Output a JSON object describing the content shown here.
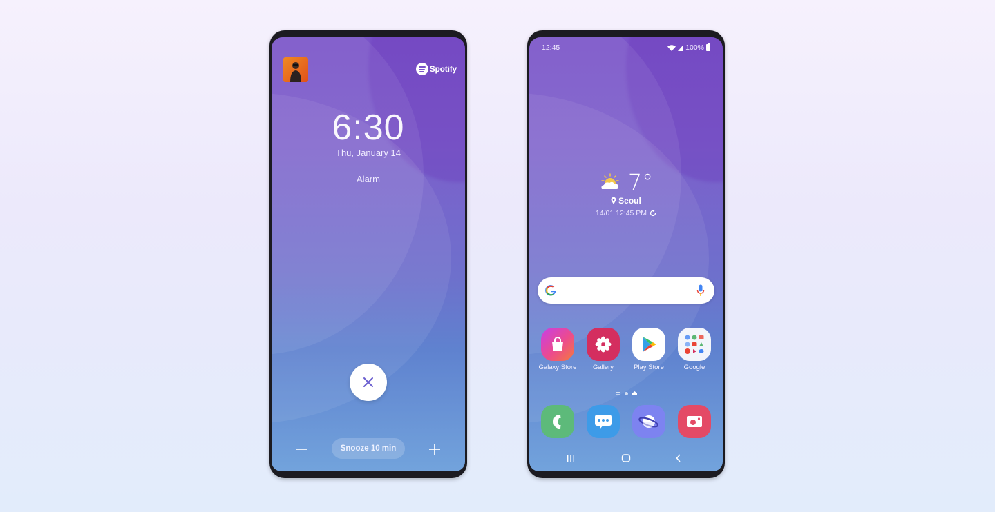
{
  "alarm_screen": {
    "music_app": "Spotify",
    "time": "6:30",
    "date": "Thu, January 14",
    "label": "Alarm",
    "dismiss_icon": "close-icon",
    "snooze_label": "Snooze 10 min",
    "snooze_decrease_icon": "minus-icon",
    "snooze_increase_icon": "plus-icon"
  },
  "home_screen": {
    "status_bar": {
      "time": "12:45",
      "battery": "100%",
      "icons": [
        "wifi-icon",
        "signal-icon",
        "battery-icon"
      ]
    },
    "weather": {
      "icon": "partly-sunny-icon",
      "temperature": "7°",
      "location": "Seoul",
      "updated": "14/01 12:45 PM"
    },
    "search": {
      "placeholder": "",
      "icons": [
        "google-g-icon",
        "mic-icon"
      ]
    },
    "apps": [
      {
        "label": "Galaxy Store",
        "icon": "galaxy-store-icon"
      },
      {
        "label": "Gallery",
        "icon": "gallery-icon"
      },
      {
        "label": "Play Store",
        "icon": "play-store-icon"
      },
      {
        "label": "Google",
        "icon": "google-folder-icon"
      }
    ],
    "page_indicator": {
      "pages": 3,
      "current": 2
    },
    "dock": [
      {
        "label": "Phone",
        "icon": "phone-icon",
        "color": "#5dba7a"
      },
      {
        "label": "Messages",
        "icon": "messages-icon",
        "color": "#3d9be8"
      },
      {
        "label": "Internet",
        "icon": "internet-icon",
        "color": "#7d83f0"
      },
      {
        "label": "Camera",
        "icon": "camera-icon",
        "color": "#e44a66"
      }
    ],
    "nav": [
      "recents-icon",
      "home-icon",
      "back-icon"
    ]
  },
  "colors": {
    "wallpaper_top": "#7b55c9",
    "wallpaper_bottom": "#72a3dc",
    "dismiss_x": "#6a5fcf"
  }
}
